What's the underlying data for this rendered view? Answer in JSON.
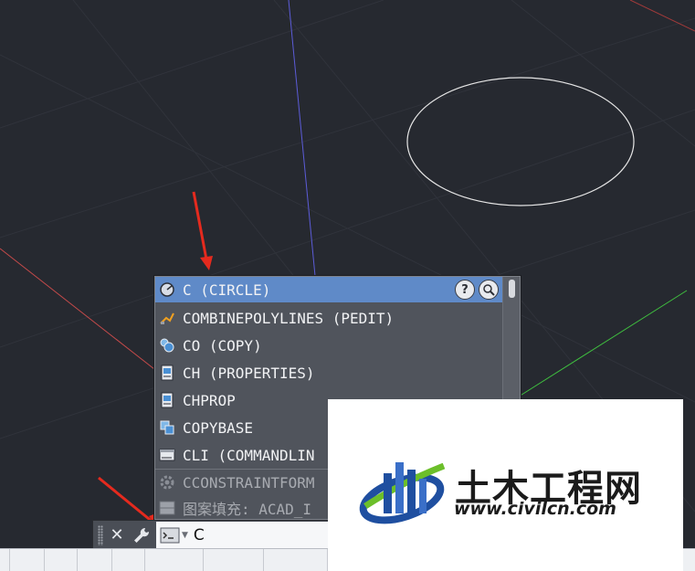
{
  "autocomplete": {
    "items": [
      {
        "label": "C (CIRCLE)",
        "icon": "circle-icon"
      },
      {
        "label": "COMBINEPOLYLINES (PEDIT)",
        "icon": "pencil-icon"
      },
      {
        "label": "CO (COPY)",
        "icon": "copy-icon"
      },
      {
        "label": "CH (PROPERTIES)",
        "icon": "properties-icon"
      },
      {
        "label": "CHPROP",
        "icon": "properties-icon"
      },
      {
        "label": "COPYBASE",
        "icon": "copybase-icon"
      },
      {
        "label": "CLI (COMMANDLIN",
        "icon": "commandline-icon"
      },
      {
        "label": "CCONSTRAINTFORM",
        "icon": "gear-icon"
      },
      {
        "label": "图案填充: ACAD_I",
        "icon": "hatch-icon"
      }
    ],
    "help_label": "?",
    "selected_index": 0
  },
  "command": {
    "input_value": "C",
    "close_label": "✕"
  },
  "watermark": {
    "brand_cn": "土木工程网",
    "url": "www.civilcn.com"
  },
  "colors": {
    "canvas": "#262930",
    "selection": "#5f8ac8",
    "arrow": "#e52a1e"
  }
}
